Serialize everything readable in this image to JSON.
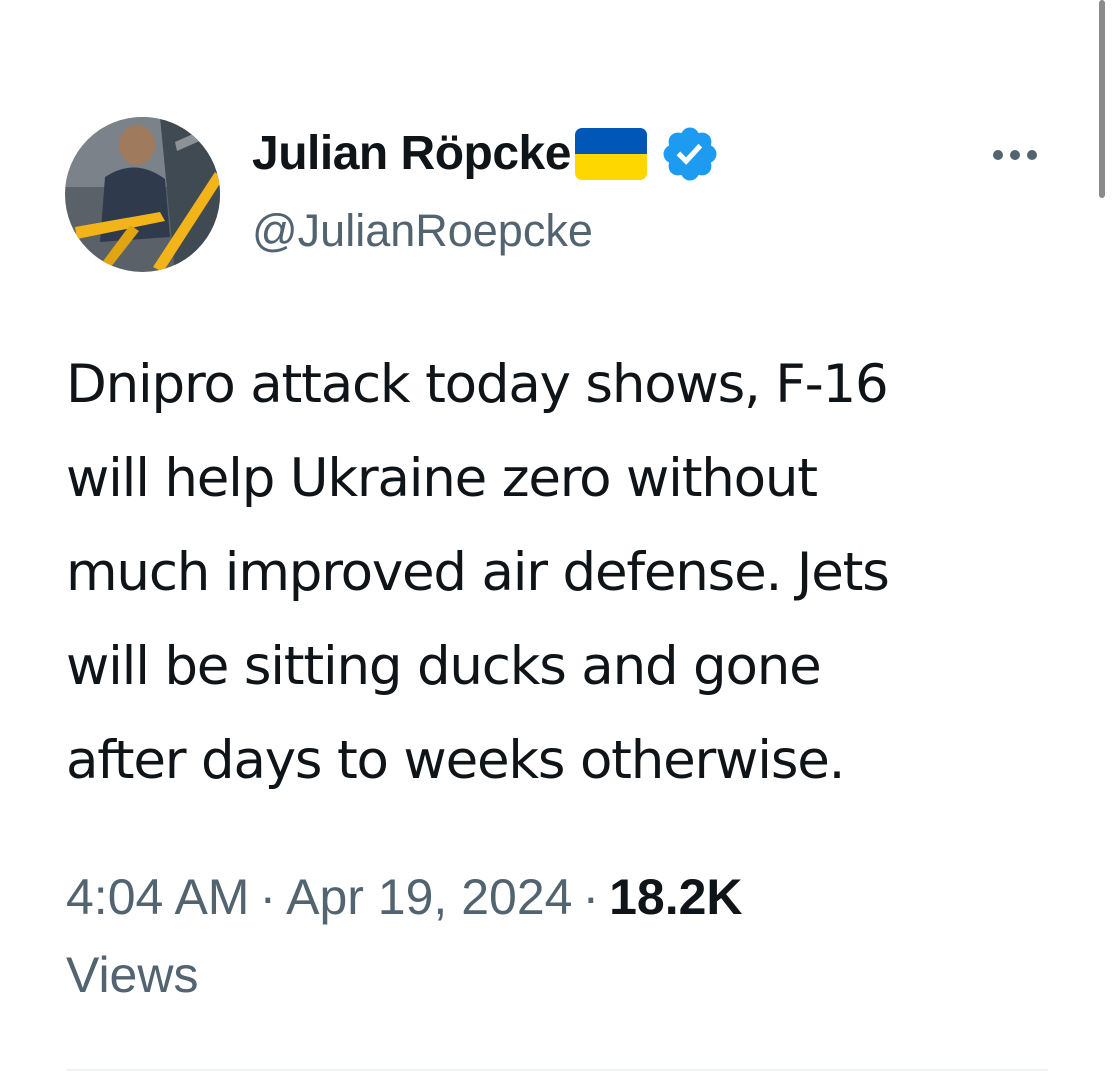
{
  "author": {
    "display_name": "Julian Röpcke",
    "handle": "@JulianRoepcke",
    "badges": [
      "ukraine-flag-icon",
      "verified-badge-icon"
    ]
  },
  "tweet": {
    "text_lines": [
      "Dnipro attack today shows, F-16",
      "will help Ukraine zero without",
      "much improved air defense. Jets",
      "will be sitting ducks and gone",
      "after days to weeks otherwise."
    ],
    "time": "4:04 AM",
    "separator": "·",
    "date": "Apr 19, 2024",
    "views_count": "18.2K",
    "views_label": "Views"
  },
  "menu": {
    "more_icon": "more-horizontal-icon"
  },
  "colors": {
    "text_primary": "#0f1419",
    "text_secondary": "#536471",
    "verified_blue": "#1d9bf0",
    "flag_blue": "#0057b7",
    "flag_yellow": "#ffd700"
  }
}
